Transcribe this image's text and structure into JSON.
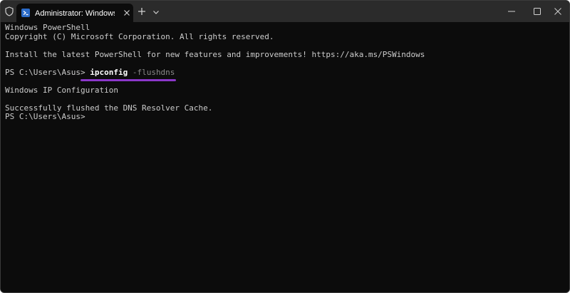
{
  "titlebar": {
    "tab_title": "Administrator: Windows PowerShell",
    "icons": {
      "shield": "shield-icon",
      "powershell": "powershell-icon",
      "close_tab": "close-icon",
      "new_tab": "plus-icon",
      "dropdown": "chevron-down-icon",
      "minimize": "minimize-icon",
      "maximize": "maximize-icon",
      "close_window": "close-icon"
    }
  },
  "terminal": {
    "banner_line1": "Windows PowerShell",
    "banner_line2": "Copyright (C) Microsoft Corporation. All rights reserved.",
    "install_line": "Install the latest PowerShell for new features and improvements! https://aka.ms/PSWindows",
    "prompt1": "PS C:\\Users\\Asus> ",
    "command": "ipconfig",
    "command_arg": " -flushdns",
    "output_title": "Windows IP Configuration",
    "output_result": "Successfully flushed the DNS Resolver Cache.",
    "prompt2": "PS C:\\Users\\Asus>"
  },
  "colors": {
    "background": "#0c0c0c",
    "titlebar": "#2b2b2b",
    "text": "#cccccc",
    "highlight_underline": "#8b37c9",
    "powershell_icon": "#2b6bc8"
  }
}
